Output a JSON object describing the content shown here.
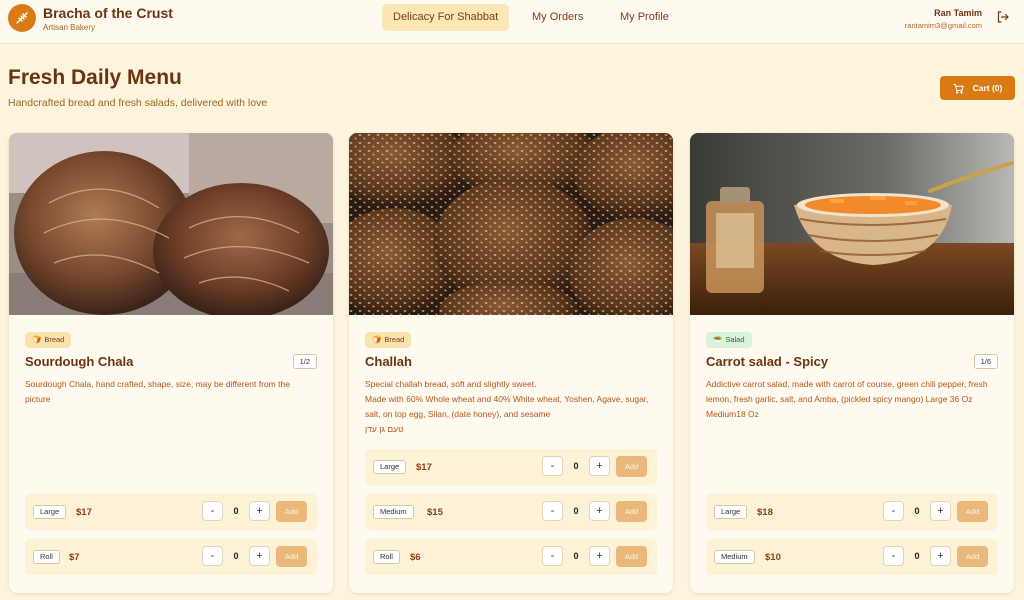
{
  "brand": {
    "title": "Bracha of the Crust",
    "subtitle": "Artisan Bakery"
  },
  "nav": [
    {
      "label": "Delicacy For Shabbat",
      "active": true
    },
    {
      "label": "My Orders",
      "active": false
    },
    {
      "label": "My Profile",
      "active": false
    }
  ],
  "user": {
    "name": "Ran Tamim",
    "email": "rantamim3@gmail.com"
  },
  "page": {
    "title": "Fresh Daily Menu",
    "subtitle": "Handcrafted bread and fresh salads, delivered with love",
    "cart_label": "Cart (0)"
  },
  "colors": {
    "accent": "#d97a15",
    "background": "#fdf4dd",
    "text": "#6b3410"
  },
  "products": [
    {
      "category": "Bread",
      "name": "Sourdough Chala",
      "count": "1/2",
      "description": [
        "Sourdough Chala, hand crafted, shape, size, may be different from the picture"
      ],
      "variants": [
        {
          "size": "Large",
          "price": "$17",
          "qty": "0",
          "add": "Add"
        },
        {
          "size": "Roll",
          "price": "$7",
          "qty": "0",
          "add": "Add"
        }
      ]
    },
    {
      "category": "Bread",
      "name": "Challah",
      "count": "",
      "description": [
        "Special challah bread, soft and slightly sweet.",
        "Made with 60% Whole wheat and 40% White wheat, Yoshen, Agave, sugar, salt, on top egg, Silan, (date honey), and sesame",
        "טעם גן עדן"
      ],
      "variants": [
        {
          "size": "Large",
          "price": "$17",
          "qty": "0",
          "add": "Add"
        },
        {
          "size": "Medium",
          "price": "$15",
          "qty": "0",
          "add": "Add"
        },
        {
          "size": "Roll",
          "price": "$6",
          "qty": "0",
          "add": "Add"
        }
      ]
    },
    {
      "category": "Salad",
      "name": "Carrot salad - Spicy",
      "count": "1/6",
      "description": [
        "Addictive carrot salad, made with carrot of course, green chili pepper, fresh lemon, fresh garlic, salt, and Amba, (pickled spicy mango) Large 36 Oz Medium18 Oz"
      ],
      "variants": [
        {
          "size": "Large",
          "price": "$18",
          "qty": "0",
          "add": "Add"
        },
        {
          "size": "Medium",
          "price": "$10",
          "qty": "0",
          "add": "Add"
        }
      ]
    }
  ],
  "qty_controls": {
    "minus": "-",
    "plus": "+"
  }
}
